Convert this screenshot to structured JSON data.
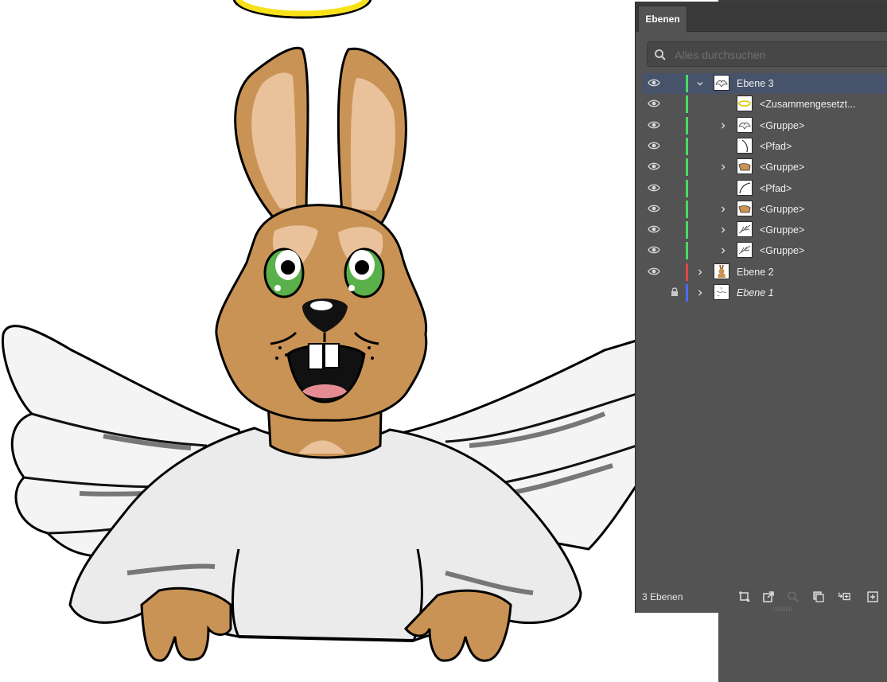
{
  "panel": {
    "tab_label": "Ebenen",
    "search_placeholder": "Alles durchsuchen",
    "footer_count": "3 Ebenen"
  },
  "layers": [
    {
      "name": "Ebene 3",
      "level": 0,
      "expander": "expanded",
      "visible": true,
      "locked": false,
      "color": "#4cd964",
      "selected": true,
      "thumb": "wing"
    },
    {
      "name": "<Zusammengesetzt...",
      "level": 1,
      "expander": "none",
      "visible": true,
      "locked": false,
      "color": "#4cd964",
      "selected": false,
      "thumb": "halo"
    },
    {
      "name": "<Gruppe>",
      "level": 1,
      "expander": "collapsed",
      "visible": true,
      "locked": false,
      "color": "#4cd964",
      "selected": false,
      "thumb": "wing"
    },
    {
      "name": "<Pfad>",
      "level": 1,
      "expander": "none",
      "visible": true,
      "locked": false,
      "color": "#4cd964",
      "selected": false,
      "thumb": "curve"
    },
    {
      "name": "<Gruppe>",
      "level": 1,
      "expander": "collapsed",
      "visible": true,
      "locked": false,
      "color": "#4cd964",
      "selected": false,
      "thumb": "paw"
    },
    {
      "name": "<Pfad>",
      "level": 1,
      "expander": "none",
      "visible": true,
      "locked": false,
      "color": "#4cd964",
      "selected": false,
      "thumb": "curve2"
    },
    {
      "name": "<Gruppe>",
      "level": 1,
      "expander": "collapsed",
      "visible": true,
      "locked": false,
      "color": "#4cd964",
      "selected": false,
      "thumb": "paw"
    },
    {
      "name": "<Gruppe>",
      "level": 1,
      "expander": "collapsed",
      "visible": true,
      "locked": false,
      "color": "#4cd964",
      "selected": false,
      "thumb": "feather"
    },
    {
      "name": "<Gruppe>",
      "level": 1,
      "expander": "collapsed",
      "visible": true,
      "locked": false,
      "color": "#4cd964",
      "selected": false,
      "thumb": "feather"
    },
    {
      "name": "Ebene 2",
      "level": 0,
      "expander": "collapsed",
      "visible": true,
      "locked": false,
      "color": "#e0474c",
      "selected": false,
      "thumb": "bunny"
    },
    {
      "name": "Ebene 1",
      "level": 0,
      "expander": "collapsed",
      "visible": false,
      "locked": true,
      "color": "#4a6cf7",
      "selected": false,
      "thumb": "sketch",
      "italic": true
    }
  ],
  "footer_icons": [
    "artboard-icon",
    "export-icon",
    "locate-object-icon",
    "clipping-mask-icon",
    "new-sublayer-icon",
    "new-layer-icon"
  ]
}
